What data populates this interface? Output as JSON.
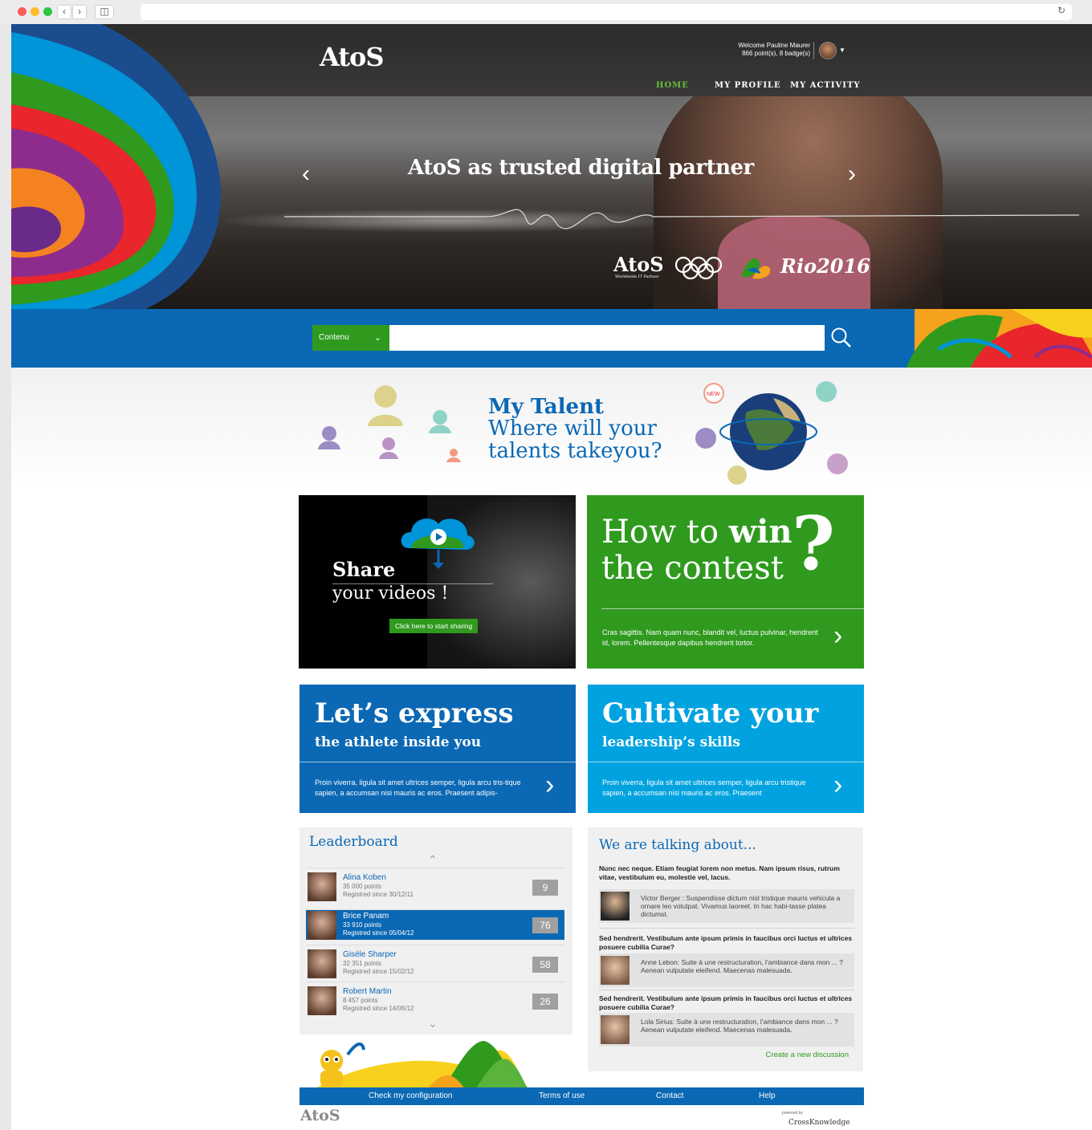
{
  "header": {
    "logo": "AtoS",
    "welcome_line1": "Welcome  Pauline Maurer",
    "welcome_line2": "866 point(s), 8 badge(s)",
    "nav": [
      {
        "label": "HOME",
        "color": "#63c23a"
      },
      {
        "label": "MY PROFILE",
        "color": "#ffffff"
      },
      {
        "label": "MY ACTIVITY",
        "color": "#ffffff"
      }
    ]
  },
  "hero": {
    "title": "AtoS as trusted digital partner",
    "logo_atos": "AtoS",
    "logo_atos_sub": "Worldwide IT Partner",
    "logo_rio": "Rio2016"
  },
  "search": {
    "select_value": "Contenu",
    "placeholder": ""
  },
  "talent": {
    "title": "My Talent",
    "subtitle": "Where will your talents takeyou?",
    "badge": "NEW"
  },
  "tiles": {
    "share": {
      "title": "Share",
      "subtitle": "your videos !",
      "button": "Click here to start sharing"
    },
    "contest": {
      "line1": "How to",
      "line1_bold": "win",
      "line2": "the contest",
      "q": "?",
      "desc": "Cras sagittis. Nam quam nunc, blandit vel, luctus pulvinar, hendrerit id, lorem. Pellentesque dapibus hendrerit tortor."
    },
    "express": {
      "title": "Let’s express",
      "subtitle": "the athlete inside you",
      "desc": "Proin viverra, ligula sit amet ultrices semper, ligula arcu tris-tique sapien, a accumsan nisi mauris ac eros. Praesent adipis-"
    },
    "cultivate": {
      "title": "Cultivate your",
      "subtitle": "leadership’s skills",
      "desc": "Proin viverra, ligula sit amet ultrices semper, ligula arcu tristique sapien, a accumsan nisi mauris ac eros. Praesent"
    }
  },
  "leaderboard": {
    "title": "Leaderboard",
    "rows": [
      {
        "name": "Alina Koben",
        "points": "35 000 points",
        "since": "Registred since 30/12/11",
        "score": "9"
      },
      {
        "name": "Brice Panam",
        "points": "33 910 points",
        "since": "Registred since 05/04/12",
        "score": "76"
      },
      {
        "name": "Gisèle Sharper",
        "points": "32 351 points",
        "since": "Registred since 15/02/12",
        "score": "58"
      },
      {
        "name": "Robert Martin",
        "points": "8 457 points",
        "since": "Registred since 14/06/12",
        "score": "26"
      }
    ]
  },
  "talking": {
    "title": "We are talking about...",
    "threads": [
      {
        "question": "Nunc nec neque. Etiam feugiat lorem non metus. Nam ipsum risus, rutrum vitae, vestibulum eu, molestie vel, lacus.",
        "comment": "Victor Berger : Suspendisse dictum nisl tristique mauris vehicula a ornare leo volutpat. Vivamus laoreet. In hac habi-tasse platea dictumst."
      },
      {
        "question": "Sed hendrerit. Vestibulum ante ipsum primis in faucibus orci luctus et ultrices posuere cubilia Curae?",
        "comment": "Anne Lebon: Suite à une restructuration, l’ambiance dans mon ... ? Aenean vulputate eleifend. Maecenas malesuada."
      },
      {
        "question": "Sed hendrerit. Vestibulum ante ipsum primis in faucibus orci luctus et ultrices posuere cubilia Curae?",
        "comment": "Lola Sirius: Suite à une restructuration, l’ambiance dans mon ... ? Aenean vulputate eleifend. Maecenas malesuada."
      }
    ],
    "create": "Create  a new discussion"
  },
  "footer": {
    "links": [
      "Check my configuration",
      "Terms of use",
      "Contact",
      "Help"
    ],
    "logo": "AtoS",
    "powered": "powered by",
    "brand": "CrossKnowledge"
  },
  "colors": {
    "blue": "#0b68b4",
    "green": "#2f9a1e",
    "cyan": "#00a3e0"
  }
}
